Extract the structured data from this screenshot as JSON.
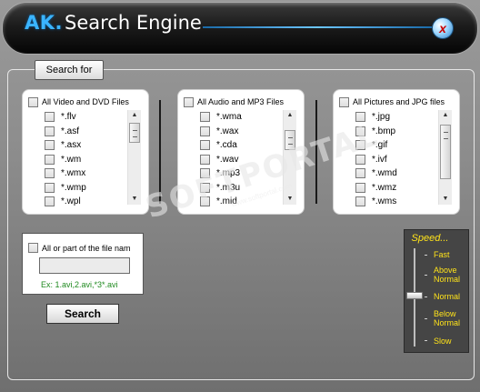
{
  "title": {
    "brand": "AK.",
    "name": "Search Engine",
    "close_glyph": "x"
  },
  "group": {
    "label": "Search for"
  },
  "video": {
    "header": "All Video and DVD Files",
    "items": [
      "*.flv",
      "*.asf",
      "*.asx",
      "*.wm",
      "*.wmx",
      "*.wmp",
      "*.wpl"
    ]
  },
  "audio": {
    "header": "All Audio and MP3 Files",
    "items": [
      "*.wma",
      "*.wax",
      "*.cda",
      "*.wav",
      "*.mp3",
      "*.m3u",
      "*.mid"
    ]
  },
  "pictures": {
    "header": "All Pictures and JPG files",
    "items": [
      "*.jpg",
      "*.bmp",
      "*.gif",
      "*.ivf",
      "*.wmd",
      "*.wmz",
      "*.wms"
    ]
  },
  "filename": {
    "header": "All or part of the file nam",
    "value": "",
    "example": "Ex: 1.avi,2.avi,*3*.avi"
  },
  "search_button": "Search",
  "speed": {
    "title": "Speed...",
    "labels": [
      "Fast",
      "Above Normal",
      "Normal",
      "Below Normal",
      "Slow"
    ],
    "selected": "Normal",
    "level_fraction": 0.5
  },
  "watermark": {
    "text": "SOFTPORTAL",
    "url": "www.softportal.com"
  },
  "colors": {
    "accent": "#3ab4ff",
    "speed_label": "#ffe31a",
    "example_text": "#1f8a1f",
    "close_x": "#c80000"
  }
}
